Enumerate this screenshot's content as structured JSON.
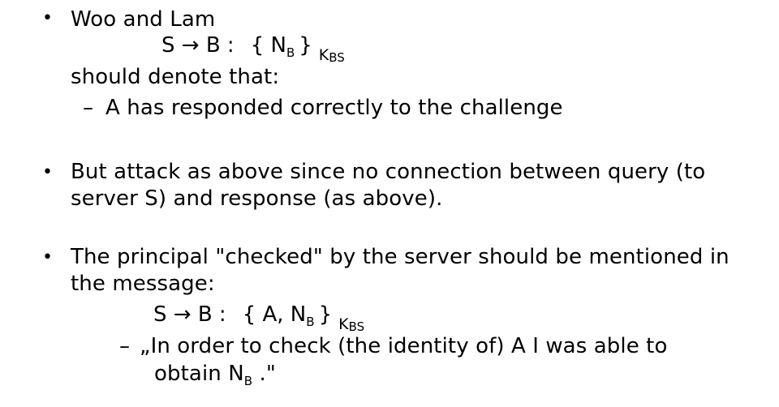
{
  "items": [
    {
      "bullet": "•",
      "lines": [
        "Woo and Lam",
        "should denote that:"
      ],
      "formula": {
        "lhs": "S → B :",
        "open": "{ N",
        "nonce_sub": "B",
        "close": "}",
        "key": "K",
        "key_sub": "BS"
      },
      "sub": {
        "dash": "–",
        "text": "A has responded correctly to the challenge"
      }
    },
    {
      "bullet": "•",
      "lines": [
        "But attack as above since no connection between  query (to",
        "server S) and response (as above)."
      ]
    },
    {
      "bullet": "•",
      "lines": [
        "The principal \"checked\" by the server should be mentioned in",
        "the message:"
      ],
      "formula": {
        "lhs": "S → B :",
        "open": "{ A, N",
        "nonce_sub": "B",
        "close": "}",
        "key": "K",
        "key_sub": "BS"
      },
      "sub": {
        "dash": "–",
        "line1": "„In order to check (the identity of) A I was able to",
        "line2_pre": "obtain N",
        "line2_sub": "B",
        "line2_post": " .\""
      }
    }
  ]
}
